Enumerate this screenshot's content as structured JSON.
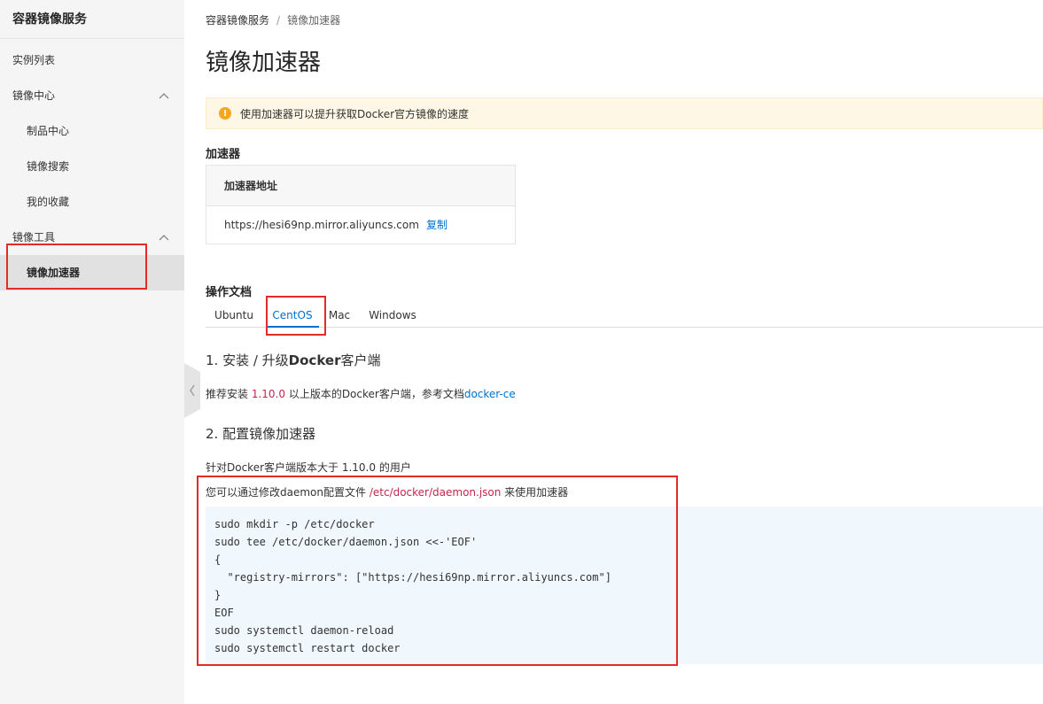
{
  "sidebar": {
    "title": "容器镜像服务",
    "items": [
      {
        "label": "实例列表"
      },
      {
        "label": "镜像中心"
      },
      {
        "label": "制品中心"
      },
      {
        "label": "镜像搜索"
      },
      {
        "label": "我的收藏"
      },
      {
        "label": "镜像工具"
      },
      {
        "label": "镜像加速器"
      }
    ]
  },
  "breadcrumb": {
    "root": "容器镜像服务",
    "sep": "/",
    "current": "镜像加速器"
  },
  "page_title": "镜像加速器",
  "notice": "使用加速器可以提升获取Docker官方镜像的速度",
  "accelerator": {
    "section_title": "加速器",
    "column_header": "加速器地址",
    "url": "https://hesi69np.mirror.aliyuncs.com",
    "copy_label": "复制"
  },
  "docs": {
    "section_title": "操作文档",
    "tabs": [
      "Ubuntu",
      "CentOS",
      "Mac",
      "Windows"
    ],
    "active_tab": "CentOS"
  },
  "step1": {
    "num": "1. 安装 / 升级",
    "bold": "Docker",
    "rest": "客户端",
    "text_a": "推荐安装 ",
    "version": "1.10.0",
    "text_b": " 以上版本的Docker客户端，参考文档",
    "link": "docker-ce"
  },
  "step2": {
    "title": "2. 配置镜像加速器",
    "line1": "针对Docker客户端版本大于 1.10.0 的用户",
    "line2_a": "您可以通过修改daemon配置文件 ",
    "line2_path": "/etc/docker/daemon.json",
    "line2_b": " 来使用加速器"
  },
  "code": [
    "sudo mkdir -p /etc/docker",
    "sudo tee /etc/docker/daemon.json <<-'EOF'",
    "{",
    "  \"registry-mirrors\": [\"https://hesi69np.mirror.aliyuncs.com\"]",
    "}",
    "EOF",
    "sudo systemctl daemon-reload",
    "sudo systemctl restart docker"
  ],
  "colors": {
    "accent": "#0070cc",
    "highlight": "#e52a2a",
    "warning": "#f5a623"
  }
}
